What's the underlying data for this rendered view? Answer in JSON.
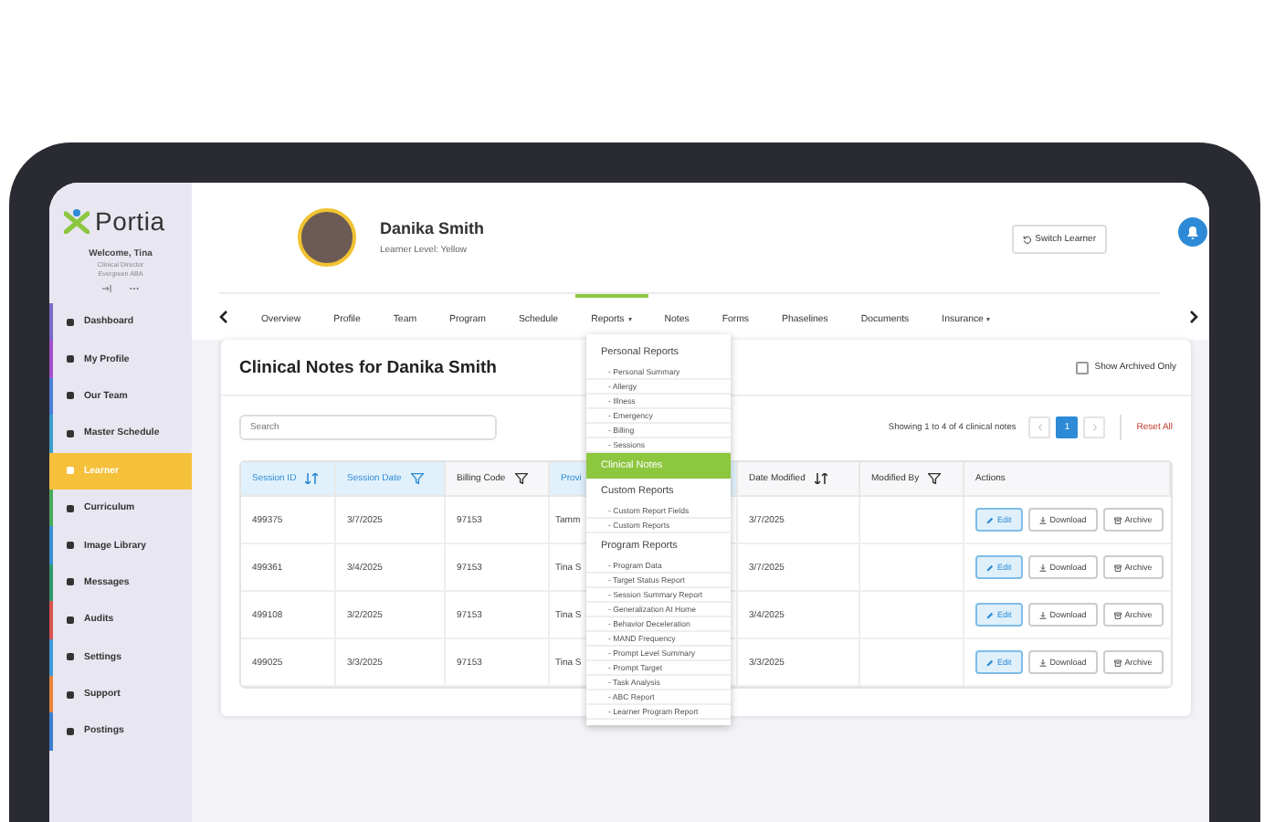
{
  "sidebar": {
    "logo": "Portia",
    "welcome": "Welcome, Tina",
    "role": "Clinical Director",
    "organization": "Evergreen ABA",
    "items": [
      {
        "label": "Dashboard",
        "selected": false,
        "color": "#7b68c9"
      },
      {
        "label": "My Profile",
        "selected": false,
        "color": "#a24fc9"
      },
      {
        "label": "Our Team",
        "selected": false,
        "color": "#4a7fd6"
      },
      {
        "label": "Master Schedule",
        "selected": false,
        "color": "#3aa0c9"
      },
      {
        "label": "Learner",
        "selected": true,
        "color": "#f5c03a"
      },
      {
        "label": "Curriculum",
        "selected": false,
        "color": "#4aaa5a"
      },
      {
        "label": "Image Library",
        "selected": false,
        "color": "#3a8fd0"
      },
      {
        "label": "Messages",
        "selected": false,
        "color": "#2e9a6a"
      },
      {
        "label": "Audits",
        "selected": false,
        "color": "#d9534f"
      },
      {
        "label": "Settings",
        "selected": false,
        "color": "#3a9ad9"
      },
      {
        "label": "Support",
        "selected": false,
        "color": "#e8843a"
      },
      {
        "label": "Postings",
        "selected": false,
        "color": "#3a7fd0"
      }
    ]
  },
  "learner": {
    "name": "Danika Smith",
    "level": "Learner Level: Yellow"
  },
  "switch_button": "Switch Learner",
  "tabs": [
    {
      "label": "Overview",
      "selected": false,
      "menu": false
    },
    {
      "label": "Profile",
      "selected": false,
      "menu": false
    },
    {
      "label": "Team",
      "selected": false,
      "menu": false
    },
    {
      "label": "Program",
      "selected": false,
      "menu": false
    },
    {
      "label": "Schedule",
      "selected": false,
      "menu": false
    },
    {
      "label": "Reports",
      "selected": true,
      "menu": true
    },
    {
      "label": "Notes",
      "selected": false,
      "menu": false
    },
    {
      "label": "Forms",
      "selected": false,
      "menu": false
    },
    {
      "label": "Phaselines",
      "selected": false,
      "menu": false
    },
    {
      "label": "Documents",
      "selected": false,
      "menu": false
    },
    {
      "label": "Insurance",
      "selected": false,
      "menu": true
    }
  ],
  "reports_menu": [
    {
      "label": "Personal Reports",
      "kind": "header",
      "selected": false
    },
    {
      "label": "- Personal Summary",
      "kind": "item",
      "selected": false
    },
    {
      "label": "- Allergy",
      "kind": "item",
      "selected": false
    },
    {
      "label": "- Illness",
      "kind": "item",
      "selected": false
    },
    {
      "label": "- Emergency",
      "kind": "item",
      "selected": false
    },
    {
      "label": "- Billing",
      "kind": "item",
      "selected": false
    },
    {
      "label": "- Sessions",
      "kind": "item",
      "selected": false
    },
    {
      "label": "Clinical Notes",
      "kind": "header",
      "selected": true
    },
    {
      "label": "Custom Reports",
      "kind": "header",
      "selected": false
    },
    {
      "label": "- Custom Report Fields",
      "kind": "item",
      "selected": false
    },
    {
      "label": "- Custom Reports",
      "kind": "item",
      "selected": false
    },
    {
      "label": "Program Reports",
      "kind": "header",
      "selected": false
    },
    {
      "label": "- Program Data",
      "kind": "item",
      "selected": false
    },
    {
      "label": "- Target Status Report",
      "kind": "item",
      "selected": false
    },
    {
      "label": "- Session Summary Report",
      "kind": "item",
      "selected": false
    },
    {
      "label": "- Generalization At Home",
      "kind": "item",
      "selected": false
    },
    {
      "label": "- Behavior Deceleration",
      "kind": "item",
      "selected": false
    },
    {
      "label": "- MAND Frequency",
      "kind": "item",
      "selected": false
    },
    {
      "label": "- Prompt Level Summary",
      "kind": "item",
      "selected": false
    },
    {
      "label": "- Prompt Target",
      "kind": "item",
      "selected": false
    },
    {
      "label": "- Task Analysis",
      "kind": "item",
      "selected": false
    },
    {
      "label": "- ABC Report",
      "kind": "item",
      "selected": false
    },
    {
      "label": "- Learner Program Report",
      "kind": "item",
      "selected": false
    }
  ],
  "card": {
    "title": "Clinical Notes for Danika Smith",
    "archived_only": {
      "label": "Show Archived Only",
      "checked": false
    },
    "search": {
      "placeholder": "Search"
    },
    "summary": "Showing 1 to 4 of 4 clinical notes",
    "page": "1",
    "reset": "Reset All"
  },
  "table": {
    "columns": [
      {
        "label": "Session ID",
        "kind": "sort",
        "active": true
      },
      {
        "label": "Session Date",
        "kind": "filter",
        "active": true
      },
      {
        "label": "Billing Code",
        "kind": "filter",
        "active": false
      },
      {
        "label": "Provi",
        "kind": "plain",
        "active": true
      },
      {
        "label": "Date Modified",
        "kind": "sort",
        "active": false
      },
      {
        "label": "Modified By",
        "kind": "filter",
        "active": false
      },
      {
        "label": "Actions",
        "kind": "plain",
        "active": false
      }
    ],
    "rows": [
      {
        "session_id": "499375",
        "session_date": "3/7/2025",
        "billing_code": "97153",
        "provider": "Tamm",
        "date_modified": "3/7/2025",
        "actions": [
          {
            "label": "Edit",
            "kind": "edit"
          },
          {
            "label": "Download",
            "kind": "download"
          },
          {
            "label": "Archive",
            "kind": "archive"
          }
        ]
      },
      {
        "session_id": "499361",
        "session_date": "3/4/2025",
        "billing_code": "97153",
        "provider": "Tina S",
        "date_modified": "3/7/2025",
        "actions": [
          {
            "label": "Edit",
            "kind": "edit"
          },
          {
            "label": "Download",
            "kind": "download"
          },
          {
            "label": "Archive",
            "kind": "archive"
          }
        ]
      },
      {
        "session_id": "499108",
        "session_date": "3/2/2025",
        "billing_code": "97153",
        "provider": "Tina S",
        "date_modified": "3/4/2025",
        "actions": [
          {
            "label": "Edit",
            "kind": "edit"
          },
          {
            "label": "Download",
            "kind": "download"
          },
          {
            "label": "Archive",
            "kind": "archive"
          }
        ]
      },
      {
        "session_id": "499025",
        "session_date": "3/3/2025",
        "billing_code": "97153",
        "provider": "Tina S",
        "date_modified": "3/3/2025",
        "actions": [
          {
            "label": "Edit",
            "kind": "edit"
          },
          {
            "label": "Download",
            "kind": "download"
          },
          {
            "label": "Archive",
            "kind": "archive"
          }
        ]
      }
    ]
  }
}
